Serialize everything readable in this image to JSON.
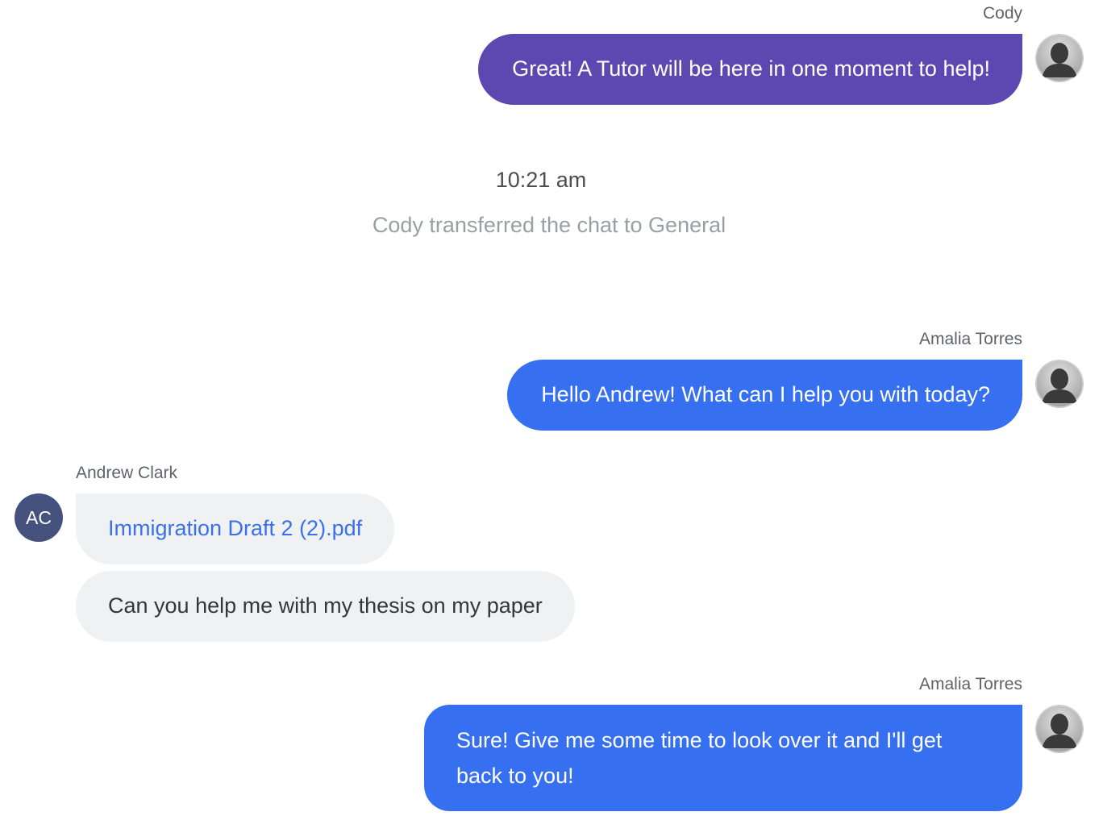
{
  "messages": [
    {
      "sender": "Cody",
      "text": "Great! A Tutor will be here in one moment to help!"
    },
    {
      "sender": "Amalia Torres",
      "text": "Hello Andrew! What can I help you with today?"
    },
    {
      "sender": "Andrew Clark",
      "initials": "AC",
      "attachment": "Immigration Draft 2 (2).pdf",
      "text": "Can you help me with my thesis on my paper"
    },
    {
      "sender": "Amalia Torres",
      "text": "Sure! Give me some time to look over it and I'll get back to you!"
    }
  ],
  "event": {
    "time": "10:21 am",
    "text": "Cody transferred the chat to General"
  },
  "colors": {
    "bot_bubble": "#5b48b0",
    "agent_bubble": "#3670f0",
    "visitor_bubble": "#f0f1f3",
    "visitor_avatar": "#46527e",
    "link": "#3a70ea"
  },
  "icons": {
    "agent_avatar": "default-user-avatar-icon"
  }
}
